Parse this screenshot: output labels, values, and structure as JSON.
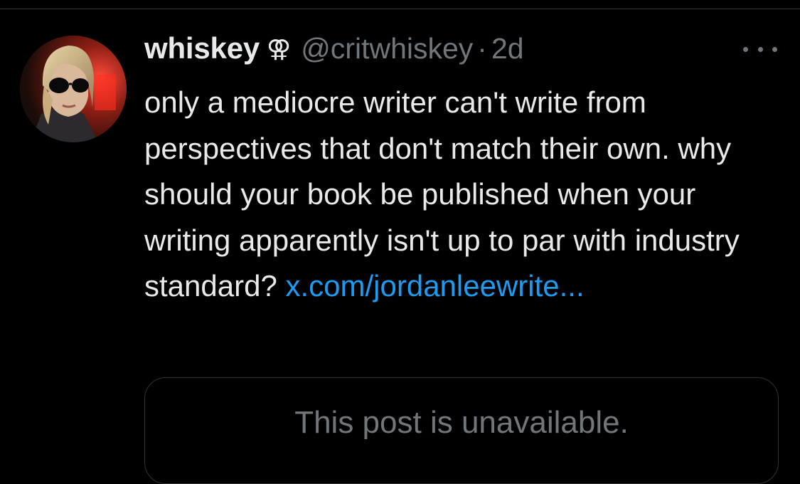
{
  "tweet": {
    "display_name": "whiskey",
    "badge": "⚢",
    "handle": "@critwhiskey",
    "separator": "·",
    "time": "2d",
    "text": "only a mediocre writer can't write from perspectives that don't match their own. why should your book be published when your writing apparently isn't up to par with industry standard?",
    "link_text": "x.com/jordanleewrite..."
  },
  "quote": {
    "unavailable_text": "This post is unavailable."
  },
  "icons": {
    "more": "more-horizontal-icon",
    "avatar": "profile-avatar"
  },
  "colors": {
    "background": "#000000",
    "text_primary": "#e7e9ea",
    "text_secondary": "#71767b",
    "link": "#1d9bf0",
    "border": "#2f3336"
  }
}
